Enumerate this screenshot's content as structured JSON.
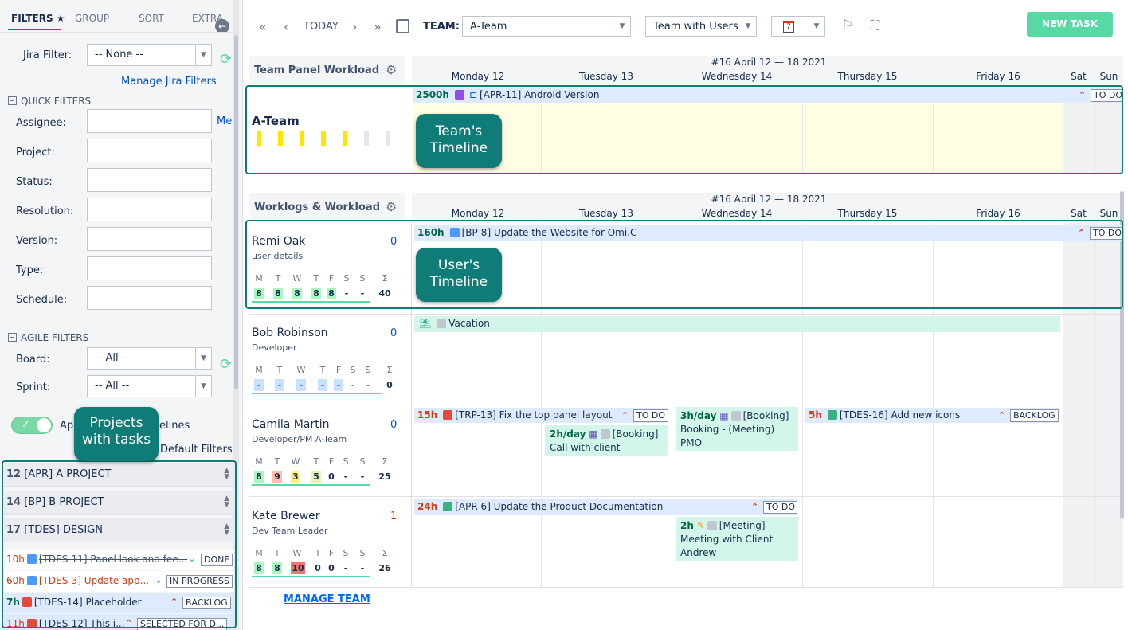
{
  "filters": {
    "tabs": [
      "FILTERS ★",
      "GROUP",
      "SORT",
      "EXTRA"
    ],
    "jira_filter_label": "Jira Filter:",
    "jira_filter_value": "-- None --",
    "manage_jira_filters": "Manage Jira Filters",
    "quick_filters_title": "QUICK FILTERS",
    "me_link": "Me",
    "fields": [
      "Assignee:",
      "Project:",
      "Status:",
      "Resolution:",
      "Version:",
      "Type:",
      "Schedule:"
    ],
    "agile_filters_title": "AGILE FILTERS",
    "board_label": "Board:",
    "board_value": "-- All --",
    "sprint_label": "Sprint:",
    "sprint_value": "-- All --",
    "apply_text_left": "Ap",
    "apply_text_right": "elines",
    "default_filters": "Default Filters",
    "projects": [
      {
        "count": "12",
        "name": "[APR] A PROJECT"
      },
      {
        "count": "14",
        "name": "[BP] B PROJECT"
      },
      {
        "count": "17",
        "name": "[TDES] DESIGN"
      }
    ],
    "tasks": [
      {
        "hours": "10h",
        "text": "[TDES-11] Panel look and fee...",
        "status": "DONE"
      },
      {
        "hours": "60h",
        "text": "[TDES-3] Update app...",
        "status": "IN PROGRESS"
      },
      {
        "hours": "7h",
        "text": "[TDES-14] Placeholder",
        "status": "BACKLOG"
      },
      {
        "hours": "11h",
        "text": "[TDES-12] This i...",
        "status": "SELECTED FOR D..."
      }
    ]
  },
  "toolbar": {
    "today": "TODAY",
    "team_label": "TEAM:",
    "team_value": "A-Team",
    "view_value": "Team with Users",
    "calendar_day": "7",
    "new_task": "NEW TASK"
  },
  "week_label": "#16 April 12 — 18 2021",
  "days": [
    "Monday 12",
    "Tuesday 13",
    "Wednesday 14",
    "Thursday 15",
    "Friday 16",
    "Sat",
    "Sun"
  ],
  "team_panel": {
    "title": "Team Panel Workload",
    "team_name": "A-Team",
    "task_hours": "2500h",
    "task_text": "[APR-11] Android Version",
    "task_status": "TO DO"
  },
  "worklogs_title": "Worklogs & Workload",
  "weekday_letters": [
    "M",
    "T",
    "W",
    "T",
    "F",
    "S",
    "S",
    "Σ"
  ],
  "users": [
    {
      "name": "Remi Oak",
      "role": "user details",
      "count": "0",
      "values": [
        "8",
        "8",
        "8",
        "8",
        "8",
        "-",
        "-",
        "40"
      ]
    },
    {
      "name": "Bob Robinson",
      "role": "Developer",
      "count": "0",
      "values": [
        "-",
        "-",
        "-",
        "-",
        "-",
        "-",
        "-",
        "0"
      ]
    },
    {
      "name": "Camila Martin",
      "role": "Developer/PM A-Team",
      "count": "0",
      "values": [
        "8",
        "9",
        "3",
        "5",
        "0",
        "-",
        "-",
        "25"
      ]
    },
    {
      "name": "Kate Brewer",
      "role": "Dev Team Leader",
      "count": "1",
      "values": [
        "8",
        "8",
        "10",
        "0",
        "0",
        "-",
        "-",
        "26"
      ]
    }
  ],
  "remi_task": {
    "hours": "160h",
    "text": "[BP-8] Update the Website for Omi.C",
    "status": "TO DO"
  },
  "bob_task": {
    "text": "Vacation"
  },
  "camila_tasks": {
    "t1_hours": "15h",
    "t1_text": "[TRP-13] Fix the top panel layout",
    "t1_status": "TO DO",
    "c1_rate": "2h/day",
    "c1_tag": "[Booking]",
    "c1_text": "Call with client",
    "c2_rate": "3h/day",
    "c2_tag": "[Booking]",
    "c2_text1": "Booking - (Meeting)",
    "c2_text2": "PMO",
    "t2_hours": "5h",
    "t2_text": "[TDES-16] Add new icons",
    "t2_status": "BACKLOG"
  },
  "kate_tasks": {
    "t1_hours": "24h",
    "t1_text": "[APR-6] Update the Product Documentation",
    "t1_status": "TO DO",
    "c1_rate": "2h",
    "c1_tag": "[Meeting]",
    "c1_text1": "Meeting with Client",
    "c1_text2": "Andrew"
  },
  "manage_team": "MANAGE TEAM",
  "annotations": {
    "team_timeline": "Team's Timeline",
    "user_timeline": "User's Timeline",
    "projects_with_tasks": "Projects with tasks"
  },
  "colors": {
    "accent_teal": "#107c78",
    "new_task_green": "#57d9a3",
    "task_bar_blue": "#deebff",
    "booking_green": "#d3f5ea",
    "workload_yellow": "#fffde2",
    "overload_red": "#f87171"
  }
}
